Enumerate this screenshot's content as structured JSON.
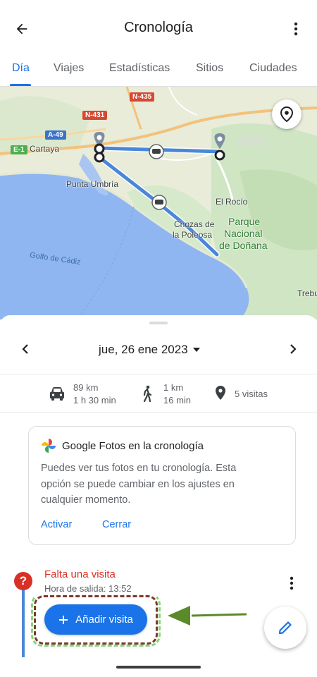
{
  "app_bar": {
    "title": "Cronología"
  },
  "tabs": [
    {
      "label": "Día",
      "active": true
    },
    {
      "label": "Viajes",
      "active": false
    },
    {
      "label": "Estadísticas",
      "active": false
    },
    {
      "label": "Sitios",
      "active": false
    },
    {
      "label": "Ciudades",
      "active": false
    }
  ],
  "map": {
    "places": [
      "Cartaya",
      "Punta Umbría",
      "El Rocío",
      "Chozas de",
      "la Poleosa",
      "Parque",
      "Nacional",
      "de Doñana",
      "Trebu",
      "Golfo de Cádiz"
    ],
    "roads": [
      "N-435",
      "N-431",
      "A-49",
      "E-1"
    ]
  },
  "day_nav": {
    "date": "jue, 26 ene 2023"
  },
  "stats": {
    "drive": {
      "distance": "89 km",
      "duration": "1 h 30 min"
    },
    "walk": {
      "distance": "1 km",
      "duration": "16 min"
    },
    "visits": "5 visitas"
  },
  "photos_card": {
    "title": "Google Fotos en la cronología",
    "body": "Puedes ver tus fotos en tu cronología. Esta opción se puede cambiar en los ajustes en cualquier momento.",
    "activate_label": "Activar",
    "close_label": "Cerrar"
  },
  "missing_visit": {
    "title": "Falta una visita",
    "departure": "Hora de salida: 13:52",
    "add_label": "Añadir visita"
  },
  "colors": {
    "accent": "#1a73e8",
    "alert": "#d93025",
    "route": "#4a87d9",
    "annotation_brown": "#7a3a2c",
    "annotation_green": "#8bd47a",
    "arrow": "#5a8a2a"
  }
}
